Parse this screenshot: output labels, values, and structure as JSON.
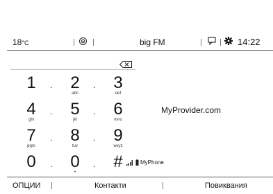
{
  "status_bar": {
    "temperature": "18",
    "temp_unit": "°C",
    "source": "big FM",
    "time": "14:22"
  },
  "keypad": {
    "keys": [
      {
        "digit": "1",
        "letters": ""
      },
      {
        "digit": "2",
        "letters": "abc"
      },
      {
        "digit": "3",
        "letters": "def"
      },
      {
        "digit": "4",
        "letters": "ghi"
      },
      {
        "digit": "5",
        "letters": "jkl"
      },
      {
        "digit": "6",
        "letters": "mno"
      },
      {
        "digit": "7",
        "letters": "pqrs"
      },
      {
        "digit": "8",
        "letters": "tuv"
      },
      {
        "digit": "9",
        "letters": "wxyz"
      },
      {
        "digit": "0",
        "letters": ""
      },
      {
        "digit": "0",
        "letters": "+"
      },
      {
        "digit": "#",
        "letters": ""
      }
    ],
    "separator": "."
  },
  "provider": "MyProvider.com",
  "phone_name": "MyPhone",
  "bottom_bar": {
    "options": "ОПЦИИ",
    "contacts": "Контакти",
    "calls": "Повиквания"
  }
}
